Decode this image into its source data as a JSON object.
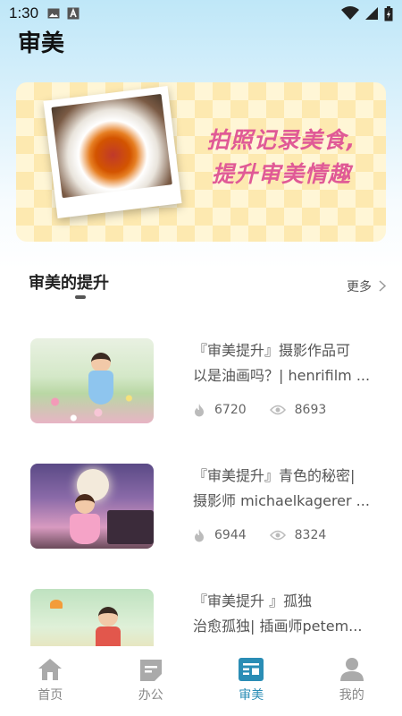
{
  "status_bar": {
    "time": "1:30",
    "left_icons": [
      "image-icon",
      "a-icon"
    ],
    "right_icons": [
      "wifi-icon",
      "signal-icon",
      "battery-icon"
    ]
  },
  "page": {
    "title": "审美"
  },
  "banner": {
    "line1": "拍照记录美食,",
    "line2": "提升审美情趣"
  },
  "section": {
    "title": "审美的提升",
    "more_label": "更多"
  },
  "cards": [
    {
      "title_line1": "『审美提升』摄影作品可",
      "title_line2": "以是油画吗？| henrifilm ...",
      "likes": "6720",
      "views": "8693"
    },
    {
      "title_line1": "『审美提升』青色的秘密|",
      "title_line2": "摄影师 michaelkagerer ...",
      "likes": "6944",
      "views": "8324"
    },
    {
      "title_line1": "『审美提升 』孤独",
      "title_line2": "治愈孤独| 插画师petem...",
      "likes": "",
      "views": ""
    }
  ],
  "tabs": [
    {
      "label": "首页",
      "icon": "home-icon",
      "active": false
    },
    {
      "label": "办公",
      "icon": "office-icon",
      "active": false
    },
    {
      "label": "审美",
      "icon": "aesthetics-icon",
      "active": true
    },
    {
      "label": "我的",
      "icon": "profile-icon",
      "active": false
    }
  ],
  "colors": {
    "accent": "#2a8db5",
    "banner_text": "#e05a96",
    "top_gradient": "#bfe7f8"
  }
}
